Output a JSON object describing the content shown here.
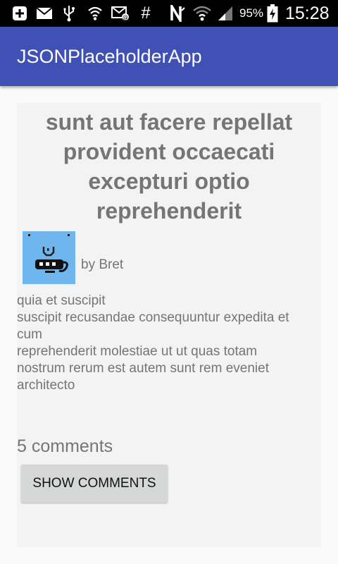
{
  "status_bar": {
    "battery_percent": "95%",
    "time": "15:28",
    "icons": [
      "add-notification-icon",
      "mail-icon",
      "usb-icon",
      "hotspot-icon",
      "photo-mail-icon",
      "hash-icon",
      "nfc-n-icon",
      "wifi-icon",
      "signal-icon",
      "battery-charging-icon"
    ]
  },
  "app_bar": {
    "title": "JSONPlaceholderApp",
    "color": "#3f51b5"
  },
  "post": {
    "title": "sunt aut facere repellat provident occaecati excepturi optio reprehenderit",
    "author": "by Bret",
    "body": "quia et suscipit\nsuscipit recusandae consequuntur expedita et cum\nreprehenderit molestiae ut ut quas totam\nnostrum rerum est autem sunt rem eveniet architecto",
    "comments_count": "5 comments",
    "show_comments_label": "SHOW COMMENTS"
  }
}
